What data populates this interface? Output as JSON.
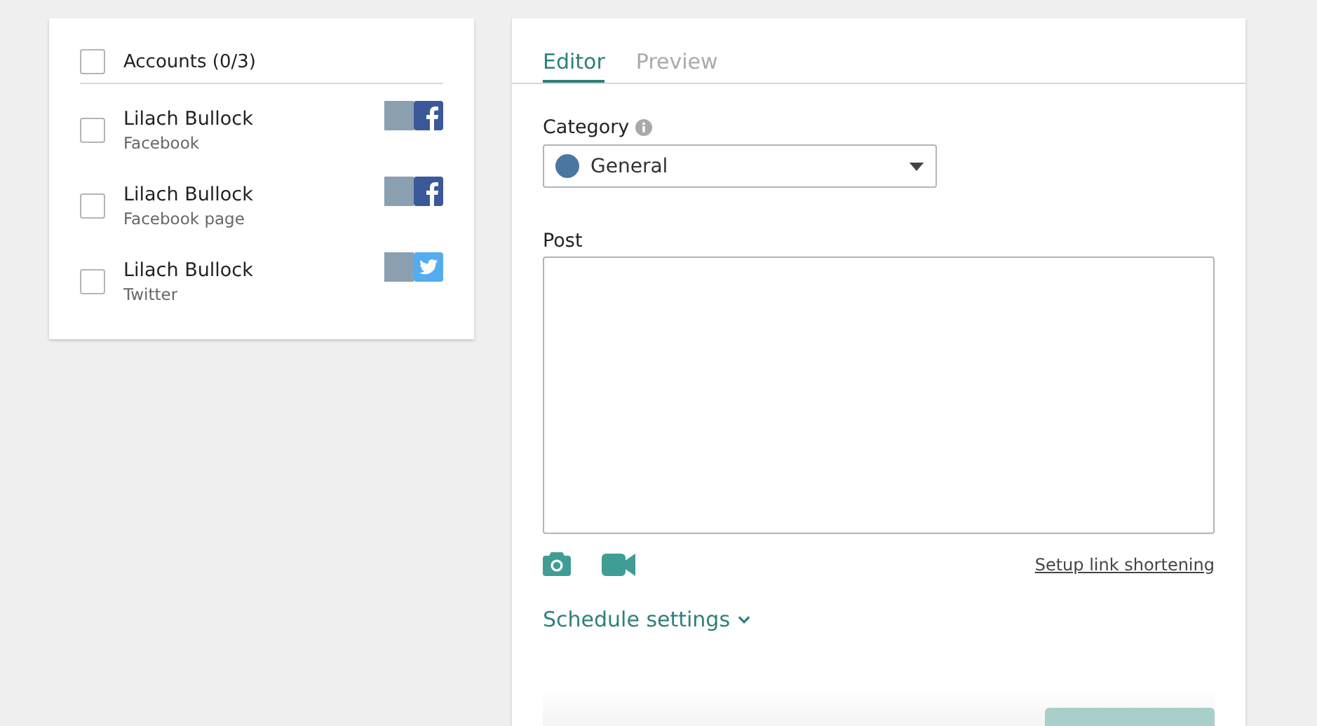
{
  "accounts": {
    "header": "Accounts (0/3)",
    "checked": false,
    "items": [
      {
        "name": "Lilach Bullock",
        "network": "Facebook",
        "kind": "facebook",
        "checked": false
      },
      {
        "name": "Lilach Bullock",
        "network": "Facebook page",
        "kind": "facebook",
        "checked": false
      },
      {
        "name": "Lilach Bullock",
        "network": "Twitter",
        "kind": "twitter",
        "checked": false
      }
    ]
  },
  "tabs": [
    {
      "label": "Editor",
      "selected": true
    },
    {
      "label": "Preview",
      "selected": false
    }
  ],
  "category": {
    "label": "Category",
    "value": "General"
  },
  "post": {
    "label": "Post"
  },
  "link": "Setup link shortening",
  "schedule": "Schedule settings"
}
